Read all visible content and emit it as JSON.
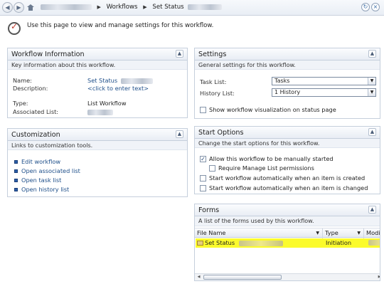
{
  "breadcrumb": {
    "site": "",
    "workflows": "Workflows",
    "set_status": "Set Status",
    "sep": "▶"
  },
  "header": {
    "intro": "Use this page to view and manage settings for this workflow."
  },
  "workflow_info": {
    "title": "Workflow Information",
    "subtitle": "Key information about this workflow.",
    "name_label": "Name:",
    "name_value": "Set Status",
    "description_label": "Description:",
    "description_value": "<click to enter text>",
    "type_label": "Type:",
    "type_value": "List Workflow",
    "assoc_label": "Associated List:"
  },
  "customization": {
    "title": "Customization",
    "subtitle": "Links to customization tools.",
    "links": [
      "Edit workflow",
      "Open associated list",
      "Open task list",
      "Open history list"
    ]
  },
  "settings": {
    "title": "Settings",
    "subtitle": "General settings for this workflow.",
    "task_list_label": "Task List:",
    "task_list_value": "Tasks",
    "history_list_label": "History List:",
    "history_list_value": "1 History",
    "show_visualization": "Show workflow visualization on status page"
  },
  "start_options": {
    "title": "Start Options",
    "subtitle": "Change the start options for this workflow.",
    "allow_manual": "Allow this workflow to be manually started",
    "require_manage": "Require Manage List permissions",
    "start_created": "Start workflow automatically when an item is created",
    "start_changed": "Start workflow automatically when an item is changed"
  },
  "forms": {
    "title": "Forms",
    "subtitle": "A list of the forms used by this workflow.",
    "columns": [
      "File Name",
      "Type",
      "Modifie"
    ],
    "row": {
      "file_name": "Set Status",
      "type": "Initiation"
    }
  },
  "colors": {
    "highlight": "#fbfb2c",
    "link": "#1d4e89",
    "panel_border": "#c5cfdc"
  },
  "icons": {
    "home": "home-icon",
    "refresh": "refresh-icon",
    "workflow": "workflow-settings-icon"
  }
}
